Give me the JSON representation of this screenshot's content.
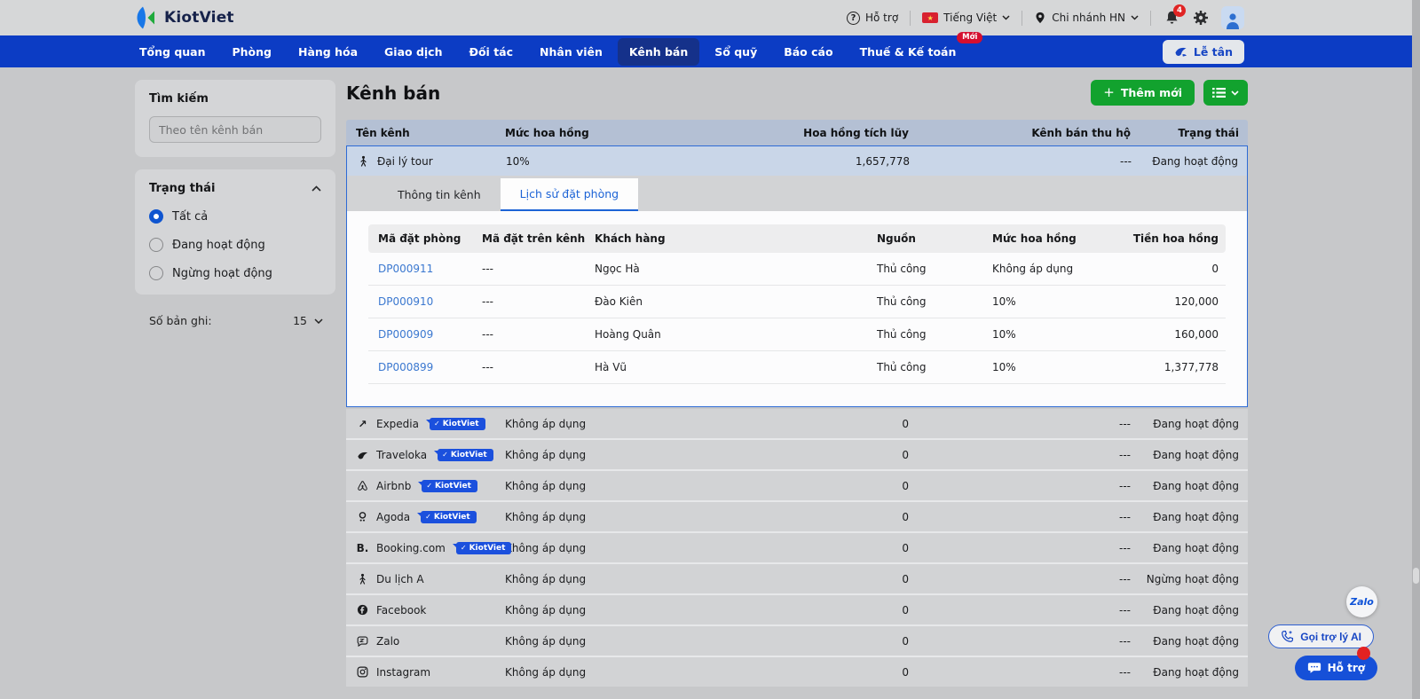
{
  "brand": {
    "name": "KiotViet"
  },
  "colors": {
    "nav_blue": "#0c3cc4",
    "green": "#12a22e",
    "badge_red": "#d50f2f",
    "link_blue": "#3b78d0",
    "kiotviet_badge": "#1b50dd",
    "table_header": "#b4c0d4",
    "selected_row": "#c9d6e8"
  },
  "icons": {
    "help": "?",
    "check": "✓",
    "plus": "+",
    "expedia": "↗",
    "booking": "B.",
    "star": "★",
    "dots": "---"
  },
  "topbar": {
    "help": "Hỗ trợ",
    "language": "Tiếng Việt",
    "branch": "Chi nhánh HN",
    "notification_count": "4"
  },
  "nav": {
    "items": [
      {
        "label": "Tổng quan"
      },
      {
        "label": "Phòng"
      },
      {
        "label": "Hàng hóa"
      },
      {
        "label": "Giao dịch"
      },
      {
        "label": "Đối tác"
      },
      {
        "label": "Nhân viên"
      },
      {
        "label": "Kênh bán"
      },
      {
        "label": "Sổ quỹ"
      },
      {
        "label": "Báo cáo"
      },
      {
        "label": "Thuế & Kế toán"
      }
    ],
    "new_badge": "Mới",
    "reception_label": "Lễ tân"
  },
  "sidebar": {
    "search": {
      "title": "Tìm kiếm",
      "placeholder": "Theo tên kênh bán"
    },
    "status_filter": {
      "title": "Trạng thái",
      "options": [
        {
          "label": "Tất cả",
          "selected": true
        },
        {
          "label": "Đang hoạt động",
          "selected": false
        },
        {
          "label": "Ngừng hoạt động",
          "selected": false
        }
      ]
    },
    "records": {
      "label": "Số bản ghi:",
      "value": "15"
    }
  },
  "main": {
    "title": "Kênh bán",
    "add_button": "Thêm mới",
    "table": {
      "headers": [
        "Tên kênh",
        "Mức hoa hồng",
        "Hoa hồng tích lũy",
        "Kênh bán thu hộ",
        "Trạng thái"
      ],
      "selected_row": {
        "name": "Đại lý tour",
        "commission": "10%",
        "accumulated": "1,657,778",
        "collect": "---",
        "status": "Đang hoạt động"
      },
      "rows": [
        {
          "name": "Expedia",
          "kiotviet": true,
          "commission": "Không áp dụng",
          "accumulated": "0",
          "collect": "---",
          "status": "Đang hoạt động"
        },
        {
          "name": "Traveloka",
          "kiotviet": true,
          "commission": "Không áp dụng",
          "accumulated": "0",
          "collect": "---",
          "status": "Đang hoạt động"
        },
        {
          "name": "Airbnb",
          "kiotviet": true,
          "commission": "Không áp dụng",
          "accumulated": "0",
          "collect": "---",
          "status": "Đang hoạt động"
        },
        {
          "name": "Agoda",
          "kiotviet": true,
          "commission": "Không áp dụng",
          "accumulated": "0",
          "collect": "---",
          "status": "Đang hoạt động"
        },
        {
          "name": "Booking.com",
          "kiotviet": true,
          "commission": "Không áp dụng",
          "accumulated": "0",
          "collect": "---",
          "status": "Đang hoạt động"
        },
        {
          "name": "Du lịch A",
          "kiotviet": false,
          "commission": "Không áp dụng",
          "accumulated": "0",
          "collect": "---",
          "status": "Ngừng hoạt động"
        },
        {
          "name": "Facebook",
          "kiotviet": false,
          "commission": "Không áp dụng",
          "accumulated": "0",
          "collect": "---",
          "status": "Đang hoạt động"
        },
        {
          "name": "Zalo",
          "kiotviet": false,
          "commission": "Không áp dụng",
          "accumulated": "0",
          "collect": "---",
          "status": "Đang hoạt động"
        },
        {
          "name": "Instagram",
          "kiotviet": false,
          "commission": "Không áp dụng",
          "accumulated": "0",
          "collect": "---",
          "status": "Đang hoạt động"
        }
      ]
    },
    "detail": {
      "tabs": [
        {
          "label": "Thông tin kênh",
          "active": false
        },
        {
          "label": "Lịch sử đặt phòng",
          "active": true
        }
      ],
      "booking_table": {
        "headers": [
          "Mã đặt phòng",
          "Mã đặt trên kênh",
          "Khách hàng",
          "Nguồn",
          "Mức hoa hồng",
          "Tiền hoa hồng"
        ],
        "rows": [
          {
            "code": "DP000911",
            "channel_code": "---",
            "customer": "Ngọc Hà",
            "source": "Thủ công",
            "commission": "Không áp dụng",
            "amount": "0"
          },
          {
            "code": "DP000910",
            "channel_code": "---",
            "customer": "Đào Kiên",
            "source": "Thủ công",
            "commission": "10%",
            "amount": "120,000"
          },
          {
            "code": "DP000909",
            "channel_code": "---",
            "customer": "Hoàng Quân",
            "source": "Thủ công",
            "commission": "10%",
            "amount": "160,000"
          },
          {
            "code": "DP000899",
            "channel_code": "---",
            "customer": "Hà Vũ",
            "source": "Thủ công",
            "commission": "10%",
            "amount": "1,377,778"
          }
        ]
      }
    }
  },
  "badge": {
    "kiotviet": "KiotViet"
  },
  "floating": {
    "zalo": "Zalo",
    "ai_button": "Gọi trợ lý AI",
    "support_button": "Hỗ trợ"
  }
}
